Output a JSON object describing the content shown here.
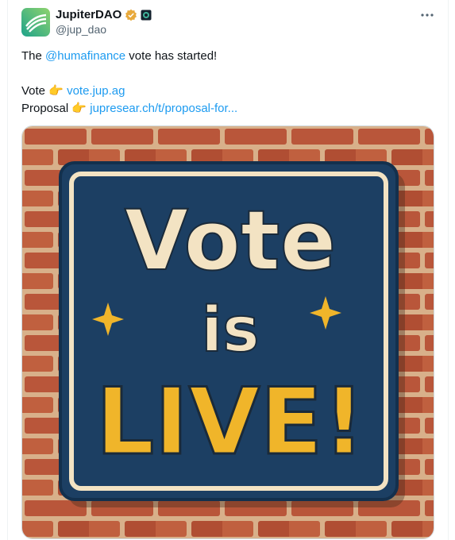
{
  "author": {
    "name": "JupiterDAO",
    "handle": "@jup_dao",
    "verified_color": "#e8a93b",
    "badge_icon": "jupiter-affiliate-badge-icon"
  },
  "tweet": {
    "line1_prefix": "The ",
    "mention": "@humafinance",
    "line1_suffix": " vote has started!",
    "vote_label": "Vote ",
    "vote_emoji": "👉",
    "vote_link": "vote.jup.ag",
    "proposal_label": "Proposal ",
    "proposal_emoji": "👉",
    "proposal_link": "jupresear.ch/t/proposal-for..."
  },
  "image": {
    "word1": "Vote",
    "word2": "is",
    "word3": "LIVE!",
    "sign_color": "#1c3f63",
    "cream_color": "#f3e3c3",
    "yellow_color": "#f0b52a",
    "brick_color": "#b9563a"
  },
  "colors": {
    "link": "#1d9bf0",
    "muted": "#536471"
  }
}
